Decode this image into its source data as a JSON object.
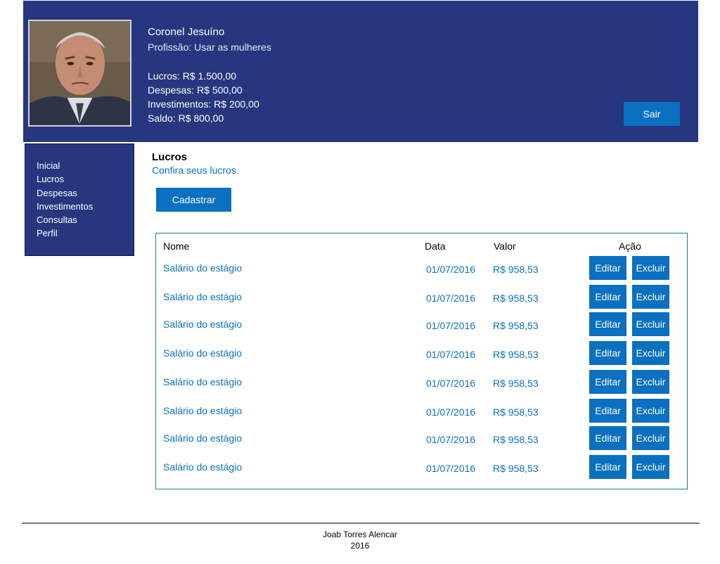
{
  "header": {
    "name": "Coronel Jesuíno",
    "profession": "Profissão: Usar as mulheres",
    "lucros": "Lucros: R$ 1.500,00",
    "despesas": "Despesas: R$ 500,00",
    "investimentos": "Investimentos: R$ 200,00",
    "saldo": "Saldo: R$ 800,00",
    "logout_label": "Sair"
  },
  "sidebar": {
    "items": [
      {
        "label": "Inicial"
      },
      {
        "label": "Lucros"
      },
      {
        "label": "Despesas"
      },
      {
        "label": "Investimentos"
      },
      {
        "label": "Consultas"
      },
      {
        "label": "Perfil"
      }
    ]
  },
  "main": {
    "title": "Lucros",
    "subtitle": "Confira seus lucros.",
    "add_label": "Cadastrar"
  },
  "table": {
    "headers": {
      "nome": "Nome",
      "data": "Data",
      "valor": "Valor",
      "acao": "Ação"
    },
    "edit_label": "Editar",
    "delete_label": "Excluir",
    "rows": [
      {
        "nome": "Salário do estágio",
        "data": "01/07/2016",
        "valor": "R$ 958,53"
      },
      {
        "nome": "Salário do estágio",
        "data": "01/07/2016",
        "valor": "R$ 958,53"
      },
      {
        "nome": "Salário do estágio",
        "data": "01/07/2016",
        "valor": "R$ 958,53"
      },
      {
        "nome": "Salário do estágio",
        "data": "01/07/2016",
        "valor": "R$ 958,53"
      },
      {
        "nome": "Salário do estágio",
        "data": "01/07/2016",
        "valor": "R$ 958,53"
      },
      {
        "nome": "Salário do estágio",
        "data": "01/07/2016",
        "valor": "R$ 958,53"
      },
      {
        "nome": "Salário do estágio",
        "data": "01/07/2016",
        "valor": "R$ 958,53"
      },
      {
        "nome": "Salário do estágio",
        "data": "01/07/2016",
        "valor": "R$ 958,53"
      }
    ]
  },
  "footer": {
    "author": "Joab Torres Alencar",
    "year": "2016"
  },
  "colors": {
    "header_bg": "#26377f",
    "accent": "#0a70bf",
    "table_border": "#127f8c"
  }
}
